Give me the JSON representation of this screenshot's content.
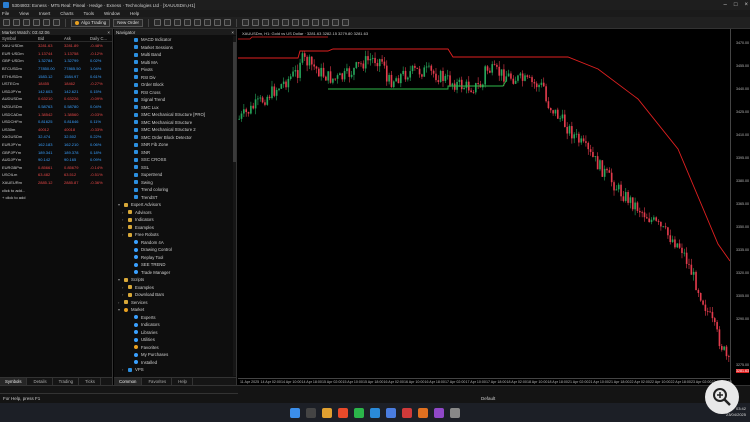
{
  "window": {
    "title": "5304803: Exness · MT5 Real: Pineal · Hedge · Exness · Technologies Ltd · [XAUUSDm,H1]"
  },
  "menu": [
    "File",
    "View",
    "Insert",
    "Charts",
    "Tools",
    "Window",
    "Help"
  ],
  "toolbar": {
    "algo_label": "Algo Trading",
    "order_label": "New Order"
  },
  "market_watch": {
    "header": "Market Watch: 03:42:06",
    "columns": [
      "Symbol",
      "Bid",
      "Ask",
      "Daily C..."
    ],
    "rows": [
      {
        "symbol": "XAU·USDm",
        "bid": "3281.63",
        "ask": "3281.89",
        "chg": "-0.48%",
        "dir": "dn"
      },
      {
        "symbol": "EUR·USDm",
        "bid": "1.13744",
        "ask": "1.13758",
        "chg": "-0.12%",
        "dir": "dn"
      },
      {
        "symbol": "GBP·USDm",
        "bid": "1.32784",
        "ask": "1.32799",
        "chg": "0.02%",
        "dir": "up"
      },
      {
        "symbol": "BTCUSDm",
        "bid": "77850.00",
        "ask": "77865.50",
        "chg": "1.04%",
        "dir": "up"
      },
      {
        "symbol": "ETHUSDm",
        "bid": "1583.12",
        "ask": "1584.97",
        "chg": "0.61%",
        "dir": "up"
      },
      {
        "symbol": "USTECm",
        "bid": "18455",
        "ask": "18462",
        "chg": "-0.27%",
        "dir": "dn"
      },
      {
        "symbol": "USDJPYm",
        "bid": "142.603",
        "ask": "142.621",
        "chg": "0.15%",
        "dir": "up"
      },
      {
        "symbol": "AUDUSDm",
        "bid": "0.63210",
        "ask": "0.63226",
        "chg": "-0.09%",
        "dir": "dn"
      },
      {
        "symbol": "NZDUSDm",
        "bid": "0.58763",
        "ask": "0.58780",
        "chg": "0.04%",
        "dir": "up"
      },
      {
        "symbol": "USDCADm",
        "bid": "1.38542",
        "ask": "1.38560",
        "chg": "-0.03%",
        "dir": "dn"
      },
      {
        "symbol": "USDCHFm",
        "bid": "0.81625",
        "ask": "0.81646",
        "chg": "0.11%",
        "dir": "up"
      },
      {
        "symbol": "US30m",
        "bid": "40012",
        "ask": "40018",
        "chg": "-0.33%",
        "dir": "dn"
      },
      {
        "symbol": "XAGUSDm",
        "bid": "32.474",
        "ask": "32.502",
        "chg": "0.22%",
        "dir": "up"
      },
      {
        "symbol": "EURJPYm",
        "bid": "162.183",
        "ask": "162.210",
        "chg": "0.06%",
        "dir": "up"
      },
      {
        "symbol": "GBPJPYm",
        "bid": "189.341",
        "ask": "189.378",
        "chg": "0.18%",
        "dir": "up"
      },
      {
        "symbol": "AUDJPYm",
        "bid": "90.142",
        "ask": "90.165",
        "chg": "0.09%",
        "dir": "up"
      },
      {
        "symbol": "EURGBPm",
        "bid": "0.85661",
        "ask": "0.85679",
        "chg": "-0.14%",
        "dir": "dn"
      },
      {
        "symbol": "USOILm",
        "bid": "63.482",
        "ask": "63.512",
        "chg": "-0.51%",
        "dir": "dn"
      },
      {
        "symbol": "XAUEURm",
        "bid": "2885.12",
        "ask": "2885.87",
        "chg": "-0.36%",
        "dir": "dn"
      },
      {
        "symbol": "click to add...",
        "bid": "",
        "ask": "",
        "chg": "",
        "dir": ""
      },
      {
        "symbol": "+ click to add",
        "bid": "",
        "ask": "",
        "chg": "",
        "dir": ""
      }
    ],
    "tabs": [
      "Symbols",
      "Details",
      "Trading",
      "Ticks"
    ]
  },
  "navigator": {
    "header": "Navigator",
    "items": [
      {
        "type": "ind",
        "label": "MACD Indicator"
      },
      {
        "type": "ind",
        "label": "Market Sessions"
      },
      {
        "type": "ind",
        "label": "Multi Band"
      },
      {
        "type": "ind",
        "label": "Multi MA"
      },
      {
        "type": "ind",
        "label": "Pivots"
      },
      {
        "type": "ind",
        "label": "RSI Div"
      },
      {
        "type": "ind",
        "label": "Order Block"
      },
      {
        "type": "ind",
        "label": "RSI Cross"
      },
      {
        "type": "ind",
        "label": "Signal Trend"
      },
      {
        "type": "ind",
        "label": "SMC Lux"
      },
      {
        "type": "ind",
        "label": "SMC Mechanical Structure [PRO]"
      },
      {
        "type": "ind",
        "label": "SMC Mechanical Structure"
      },
      {
        "type": "ind",
        "label": "SMC Mechanical Structure 2"
      },
      {
        "type": "ind",
        "label": "SMC Order Block Detector"
      },
      {
        "type": "ind",
        "label": "SNR Fib Zone"
      },
      {
        "type": "ind",
        "label": "SNR"
      },
      {
        "type": "ind",
        "label": "SSC CROSS"
      },
      {
        "type": "ind",
        "label": "SSL"
      },
      {
        "type": "ind",
        "label": "Supertrend"
      },
      {
        "type": "ind",
        "label": "Swing"
      },
      {
        "type": "ind",
        "label": "Trend coloring"
      },
      {
        "type": "ind",
        "label": "TrendST"
      },
      {
        "type": "folder",
        "label": "Expert Advisors",
        "caret": "▾"
      },
      {
        "type": "fold",
        "label": "Advisors",
        "caret": "›"
      },
      {
        "type": "fold",
        "label": "Indicators",
        "caret": "›"
      },
      {
        "type": "fold",
        "label": "Examples",
        "caret": "›"
      },
      {
        "type": "fold",
        "label": "Free Robots",
        "caret": "›"
      },
      {
        "type": "ea",
        "label": "Random 4A"
      },
      {
        "type": "ea",
        "label": "Drawing Control"
      },
      {
        "type": "ea",
        "label": "Replay Tool"
      },
      {
        "type": "ea",
        "label": "SEE TREND"
      },
      {
        "type": "ea",
        "label": "Trade Manager"
      },
      {
        "type": "folder",
        "label": "Scripts",
        "caret": "▾"
      },
      {
        "type": "fold",
        "label": "Examples",
        "caret": "›"
      },
      {
        "type": "fold",
        "label": "Download Bars",
        "caret": "›"
      },
      {
        "type": "folder",
        "label": "Services",
        "caret": "›"
      },
      {
        "type": "mk",
        "label": "Market",
        "caret": "▾"
      },
      {
        "type": "ea",
        "label": "Experts"
      },
      {
        "type": "ea",
        "label": "Indicators"
      },
      {
        "type": "ea",
        "label": "Libraries"
      },
      {
        "type": "ea",
        "label": "Utilities"
      },
      {
        "type": "mk",
        "label": "Favorites"
      },
      {
        "type": "ea",
        "label": "My Purchases"
      },
      {
        "type": "ea",
        "label": "Installed"
      },
      {
        "type": "ind",
        "label": "VPS",
        "caret": "›"
      }
    ],
    "tabs": [
      "Common",
      "Favorites",
      "Help"
    ]
  },
  "chart": {
    "title": "XAUUSDm, H1: Gold vs US Dollar · 3281.63 3282.15 3279.80 3281.63",
    "price_ticks": [
      "3470.00",
      "3455.00",
      "3440.00",
      "3425.00",
      "3410.00",
      "3395.00",
      "3380.00",
      "3365.00",
      "3350.00",
      "3335.00",
      "3320.00",
      "3305.00",
      "3290.00",
      "3281.63",
      "3275.00"
    ],
    "time_ticks": [
      "11 Apr 2025",
      "14 Apr 02:00",
      "14 Apr 10:00",
      "14 Apr 18:00",
      "15 Apr 02:00",
      "15 Apr 10:00",
      "15 Apr 18:00",
      "16 Apr 02:00",
      "16 Apr 10:00",
      "16 Apr 18:00",
      "17 Apr 02:00",
      "17 Apr 10:00",
      "17 Apr 18:00",
      "18 Apr 02:00",
      "18 Apr 10:00",
      "18 Apr 18:00",
      "21 Apr 02:00",
      "21 Apr 10:00",
      "21 Apr 18:00",
      "22 Apr 02:00",
      "22 Apr 10:00",
      "22 Apr 18:00",
      "23 Apr 02:00",
      "23 Apr 10:00"
    ],
    "colors": {
      "bull": "#26a65b",
      "bear": "#e33b4c",
      "trend_bear": "#e02020",
      "trend_bull": "#2fb84a"
    }
  },
  "status": {
    "left": "For Help, press F1",
    "mid": "Default"
  },
  "tray": {
    "time": "03:42",
    "date": "23/04/2025"
  }
}
